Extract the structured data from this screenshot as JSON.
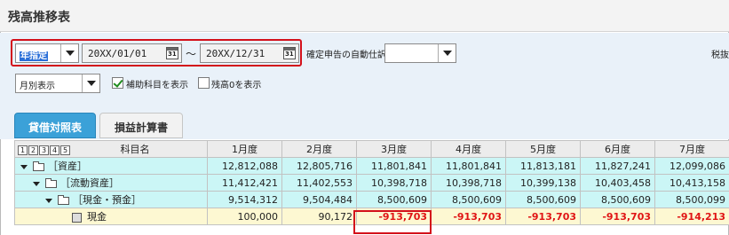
{
  "window": {
    "title": "残高推移表"
  },
  "filters": {
    "period_type": "年指定",
    "date_from": "20XX/01/01",
    "date_to": "20XX/12/31",
    "range_separator": "～",
    "calendar_icon_text": "31",
    "auto_entry_label": "確定申告の自動仕訳",
    "auto_entry_value": "",
    "tax_label": "税抜",
    "display_unit": "月別表示",
    "show_sub_accounts_label": "補助科目を表示",
    "show_sub_accounts": true,
    "show_zero_balance_label": "残高0を表示",
    "show_zero_balance": false
  },
  "tabs": [
    {
      "label": "貸借対照表",
      "active": true
    },
    {
      "label": "損益計算書",
      "active": false
    }
  ],
  "table": {
    "level_buttons": [
      "1",
      "2",
      "3",
      "4",
      "5"
    ],
    "header_account": "科目名",
    "columns": [
      "1月度",
      "2月度",
      "3月度",
      "4月度",
      "5月度",
      "6月度",
      "7月度"
    ],
    "rows": [
      {
        "name": "［資産］",
        "values": [
          "12,812,088",
          "12,805,716",
          "11,801,841",
          "11,801,841",
          "11,813,181",
          "11,827,241",
          "12,099,086"
        ]
      },
      {
        "name": "［流動資産］",
        "values": [
          "11,412,421",
          "11,402,553",
          "10,398,718",
          "10,398,718",
          "10,399,138",
          "10,403,458",
          "10,413,158"
        ]
      },
      {
        "name": "［現金・預金］",
        "values": [
          "9,514,312",
          "9,504,484",
          "8,500,609",
          "8,500,609",
          "8,500,609",
          "8,500,609",
          "8,500,099"
        ]
      },
      {
        "name": "現金",
        "values": [
          "100,000",
          "90,172",
          "-913,703",
          "-913,703",
          "-913,703",
          "-913,703",
          "-914,213"
        ]
      }
    ]
  }
}
